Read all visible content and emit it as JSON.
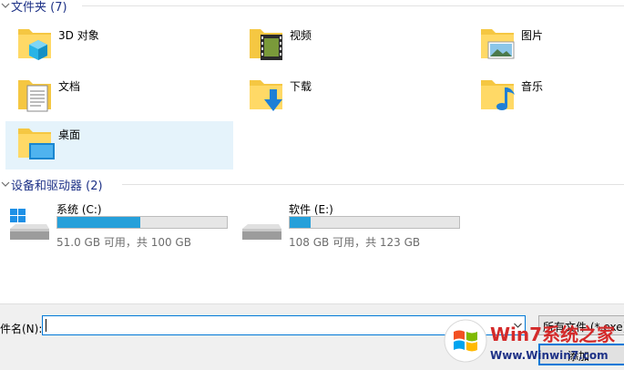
{
  "folders_group": {
    "title": "文件夹 (7)"
  },
  "folders": [
    {
      "label": "3D 对象",
      "icon": "3d-objects-folder-icon"
    },
    {
      "label": "视频",
      "icon": "videos-folder-icon"
    },
    {
      "label": "图片",
      "icon": "pictures-folder-icon"
    },
    {
      "label": "文档",
      "icon": "documents-folder-icon"
    },
    {
      "label": "下载",
      "icon": "downloads-folder-icon"
    },
    {
      "label": "音乐",
      "icon": "music-folder-icon"
    },
    {
      "label": "桌面",
      "icon": "desktop-folder-icon",
      "selected": true
    }
  ],
  "drives_group": {
    "title": "设备和驱动器 (2)"
  },
  "drives": [
    {
      "name": "系统 (C:)",
      "space": "51.0 GB 可用，共 100 GB",
      "used_fraction": 0.49,
      "icon": "windows-drive-icon"
    },
    {
      "name": "软件 (E:)",
      "space": "108 GB 可用，共 123 GB",
      "used_fraction": 0.122,
      "icon": "hard-drive-icon"
    }
  ],
  "file_bar": {
    "filename_label": "件名(N):",
    "filename_value": "",
    "type_filter": "所有文件 (*.exe)",
    "add_button": "添加"
  },
  "watermark": {
    "brand": "Win7系统之家",
    "url": "Www.Winwin7.com"
  },
  "colors": {
    "accent": "#0078d7",
    "header_text": "#1e3287",
    "bar_fill": "#26a0da",
    "selected_bg": "#e5f3fb"
  }
}
